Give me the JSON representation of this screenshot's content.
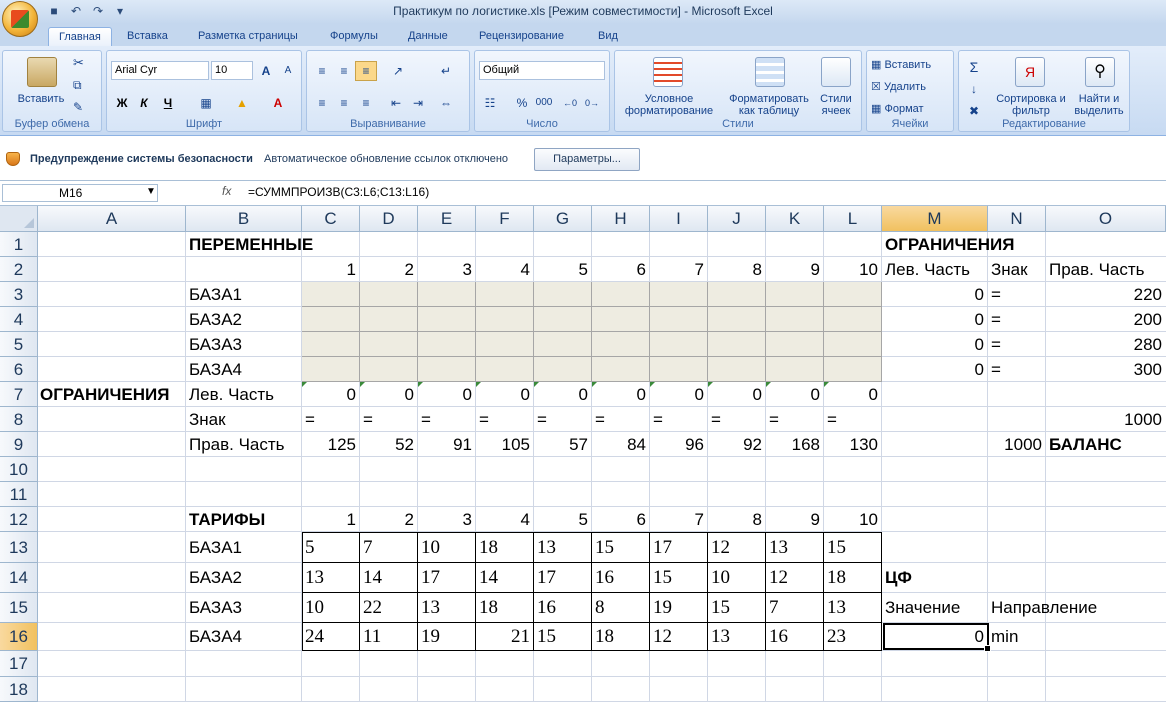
{
  "window": {
    "title": "Практикум по логистике.xls  [Режим совместимости] - Microsoft Excel"
  },
  "ribbon_tabs": [
    "Главная",
    "Вставка",
    "Разметка страницы",
    "Формулы",
    "Данные",
    "Рецензирование",
    "Вид"
  ],
  "ribbon": {
    "clipboard": {
      "label": "Буфер обмена",
      "paste": "Вставить"
    },
    "font": {
      "label": "Шрифт",
      "name": "Arial Cyr",
      "size": "10",
      "bold": "Ж",
      "italic": "К",
      "underline": "Ч"
    },
    "alignment": {
      "label": "Выравнивание"
    },
    "number": {
      "label": "Число",
      "format": "Общий",
      "percent": "%",
      "thousands": "000"
    },
    "styles": {
      "label": "Стили",
      "cond_fmt": "Условное форматирование",
      "fmt_table": "Форматировать как таблицу",
      "cell_styles": "Стили ячеек"
    },
    "cells": {
      "label": "Ячейки",
      "insert": "Вставить",
      "delete": "Удалить",
      "format": "Формат"
    },
    "editing": {
      "label": "Редактирование",
      "sort": "Сортировка и фильтр",
      "find": "Найти и выделить"
    }
  },
  "security": {
    "title": "Предупреждение системы безопасности",
    "message": "Автоматическое обновление ссылок отключено",
    "button": "Параметры..."
  },
  "formula_bar": {
    "name_box": "M16",
    "fx": "fx",
    "formula": "=СУММПРОИЗВ(C3:L6;C13:L16)"
  },
  "columns": [
    "A",
    "B",
    "C",
    "D",
    "E",
    "F",
    "G",
    "H",
    "I",
    "J",
    "K",
    "L",
    "M",
    "N",
    "O"
  ],
  "rows": [
    "1",
    "2",
    "3",
    "4",
    "5",
    "6",
    "7",
    "8",
    "9",
    "10",
    "11",
    "12",
    "13",
    "14",
    "15",
    "16",
    "17",
    "18"
  ],
  "sheet": {
    "vars_title": "ПЕРЕМЕННЫЕ",
    "constraints_title": "ОГРАНИЧЕНИЯ",
    "constraints_label": "ОГРАНИЧЕНИЯ",
    "col_numbers": [
      "1",
      "2",
      "3",
      "4",
      "5",
      "6",
      "7",
      "8",
      "9",
      "10"
    ],
    "lhs_header": "Лев. Часть",
    "sign_header": "Знак",
    "rhs_header": "Прав. Часть",
    "bases": [
      "БАЗА1",
      "БАЗА2",
      "БАЗА3",
      "БАЗА4"
    ],
    "base_constraints": [
      {
        "lhs": "0",
        "sign": "=",
        "rhs": "220"
      },
      {
        "lhs": "0",
        "sign": "=",
        "rhs": "200"
      },
      {
        "lhs": "0",
        "sign": "=",
        "rhs": "280"
      },
      {
        "lhs": "0",
        "sign": "=",
        "rhs": "300"
      }
    ],
    "row7_label": "Лев. Часть",
    "row7_values": [
      "0",
      "0",
      "0",
      "0",
      "0",
      "0",
      "0",
      "0",
      "0",
      "0"
    ],
    "row8_label": "Знак",
    "row8_values": [
      "=",
      "=",
      "=",
      "=",
      "=",
      "=",
      "=",
      "=",
      "=",
      "="
    ],
    "row8_o": "1000",
    "row9_label": "Прав. Часть",
    "row9_values": [
      "125",
      "52",
      "91",
      "105",
      "57",
      "84",
      "96",
      "92",
      "168",
      "130"
    ],
    "row9_n": "1000",
    "balance": "БАЛАНС",
    "tariffs_title": "ТАРИФЫ",
    "tariffs": [
      [
        "5",
        "7",
        "10",
        "18",
        "13",
        "15",
        "17",
        "12",
        "13",
        "15"
      ],
      [
        "13",
        "14",
        "17",
        "14",
        "17",
        "16",
        "15",
        "10",
        "12",
        "18"
      ],
      [
        "10",
        "22",
        "13",
        "18",
        "16",
        "8",
        "19",
        "15",
        "7",
        "13"
      ],
      [
        "24",
        "11",
        "19",
        "21",
        "15",
        "18",
        "12",
        "13",
        "16",
        "23"
      ]
    ],
    "cf_title": "ЦФ",
    "value_label": "Значение",
    "direction_label": "Направление",
    "value": "0",
    "direction": "min"
  }
}
